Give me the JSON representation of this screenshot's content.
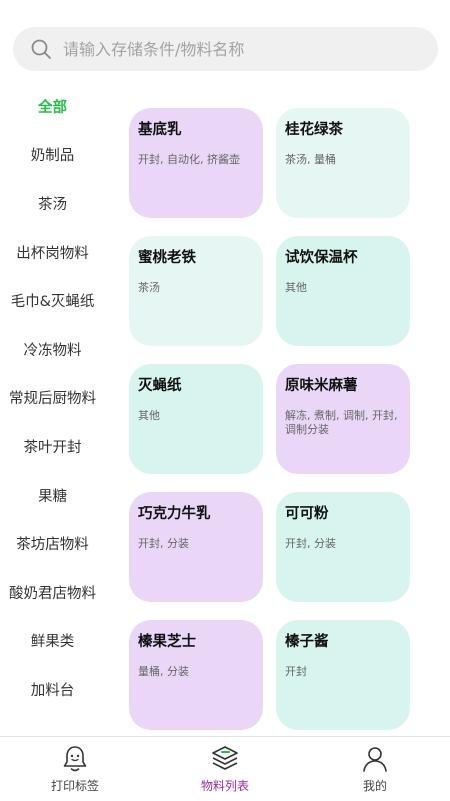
{
  "search": {
    "placeholder": "请输入存储条件/物料名称"
  },
  "sidebar": {
    "items": [
      {
        "label": "全部",
        "active": true
      },
      {
        "label": "奶制品"
      },
      {
        "label": "茶汤"
      },
      {
        "label": "出杯岗物料"
      },
      {
        "label": "毛巾&灭蝇纸"
      },
      {
        "label": "冷冻物料"
      },
      {
        "label": "常规后厨物料"
      },
      {
        "label": "茶叶开封"
      },
      {
        "label": "果糖"
      },
      {
        "label": "茶坊店物料"
      },
      {
        "label": "酸奶君店物料"
      },
      {
        "label": "鲜果类"
      },
      {
        "label": "加料台"
      }
    ]
  },
  "colors": {
    "purple_card": "#ead7f7",
    "mint_card": "#d7f5ee",
    "light_mint_card": "#e6f7f3",
    "accent_green": "#2db84a",
    "accent_purple": "#9b2d9b"
  },
  "materials": [
    {
      "name": "基底乳",
      "tags": "开封, 自动化, 挤酱壶",
      "color": "#ead7f7"
    },
    {
      "name": "桂花绿茶",
      "tags": "茶汤, 量桶",
      "color": "#e6f7f3"
    },
    {
      "name": "蜜桃老铁",
      "tags": "茶汤",
      "color": "#e6f7f3"
    },
    {
      "name": "试饮保温杯",
      "tags": "其他",
      "color": "#d7f5ee"
    },
    {
      "name": "灭蝇纸",
      "tags": "其他",
      "color": "#d7f5ee"
    },
    {
      "name": "原味米麻薯",
      "tags": "解冻, 煮制, 调制, 开封, 调制分装",
      "color": "#ead7f7"
    },
    {
      "name": "巧克力牛乳",
      "tags": "开封, 分装",
      "color": "#ead7f7"
    },
    {
      "name": "可可粉",
      "tags": "开封, 分装",
      "color": "#d7f5ee"
    },
    {
      "name": "榛果芝士",
      "tags": "量桶, 分装",
      "color": "#ead7f7"
    },
    {
      "name": "榛子酱",
      "tags": "开封",
      "color": "#d7f5ee"
    }
  ],
  "tabbar": {
    "items": [
      {
        "label": "打印标签",
        "icon": "bell-icon"
      },
      {
        "label": "物料列表",
        "icon": "layers-icon",
        "active": true
      },
      {
        "label": "我的",
        "icon": "user-icon"
      }
    ]
  }
}
